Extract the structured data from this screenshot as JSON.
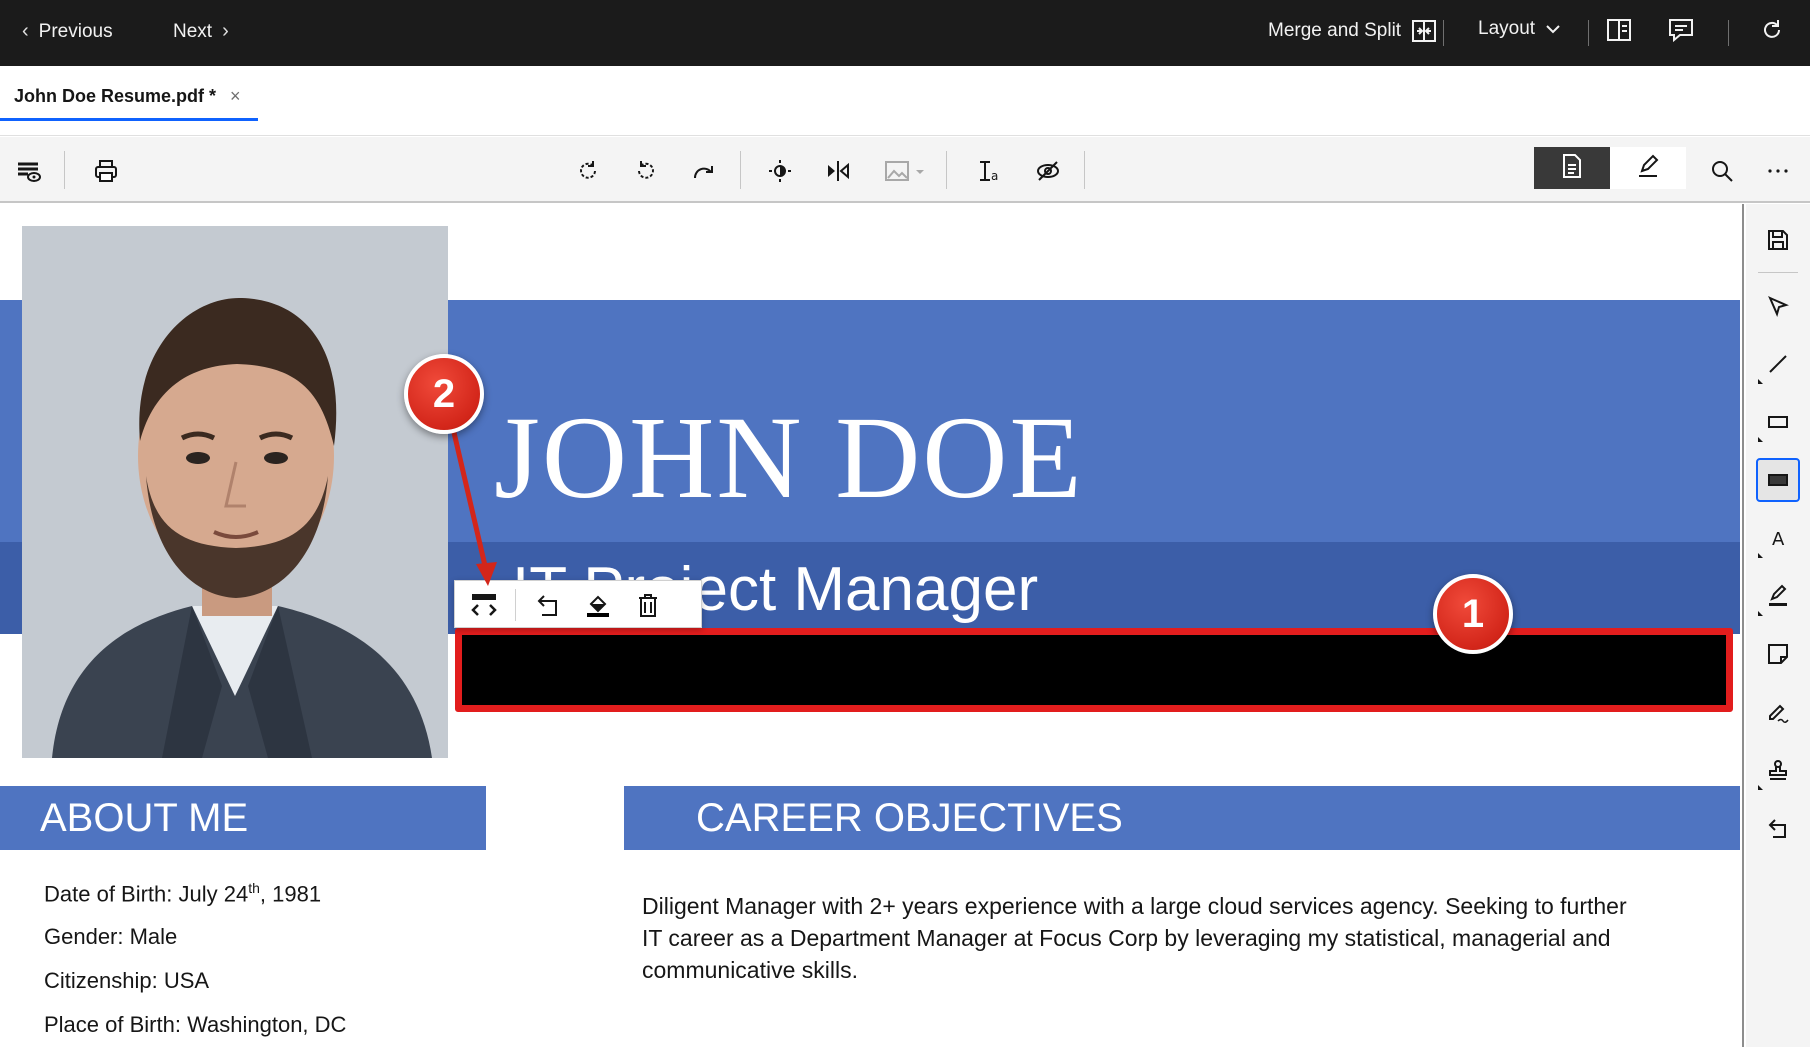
{
  "topbar": {
    "previous_label": "Previous",
    "next_label": "Next",
    "merge_split_label": "Merge and Split",
    "layout_label": "Layout"
  },
  "tab": {
    "title": "John Doe Resume.pdf *",
    "close_glyph": "×"
  },
  "toolbar": {
    "icons": [
      "view-options-icon",
      "print-icon",
      "rotate-clockwise-icon",
      "rotate-counterclockwise-icon",
      "redo-icon",
      "brightness-icon",
      "flip-icon",
      "image-icon",
      "text-recognition-icon",
      "hide-icon"
    ],
    "modes": [
      "document-mode",
      "annotate-mode"
    ]
  },
  "document": {
    "name": "JOHN DOE",
    "job_title": "IT Project Manager",
    "about_heading": "ABOUT ME",
    "career_heading": "CAREER OBJECTIVES",
    "about": {
      "dob_prefix": "Date of Birth: July 24",
      "dob_sup": "th",
      "dob_suffix": ", 1981",
      "gender": "Gender: Male",
      "citizenship": "Citizenship: USA",
      "place_of_birth": "Place of Birth: Washington, DC"
    },
    "career_text": "Diligent Manager with 2+ years experience with a large cloud services agency. Seeking to further IT career as a Department Manager at Focus Corp  by leveraging my statistical, managerial and communicative skills.",
    "colors": {
      "band": "#4f74c1",
      "band_dark": "#3c5ea8",
      "redaction": "#000000",
      "callout": "#d3261a"
    }
  },
  "float_toolbar": {
    "icons": [
      "expand-width-icon",
      "undo-icon",
      "fill-color-icon",
      "delete-icon"
    ]
  },
  "callouts": {
    "one": "1",
    "two": "2"
  },
  "right_rail": {
    "icons": [
      "save-icon",
      "select-icon",
      "line-icon",
      "rectangle-icon",
      "redact-rectangle-icon",
      "text-icon",
      "highlight-icon",
      "note-icon",
      "signature-icon",
      "stamp-icon",
      "undo-icon"
    ]
  }
}
